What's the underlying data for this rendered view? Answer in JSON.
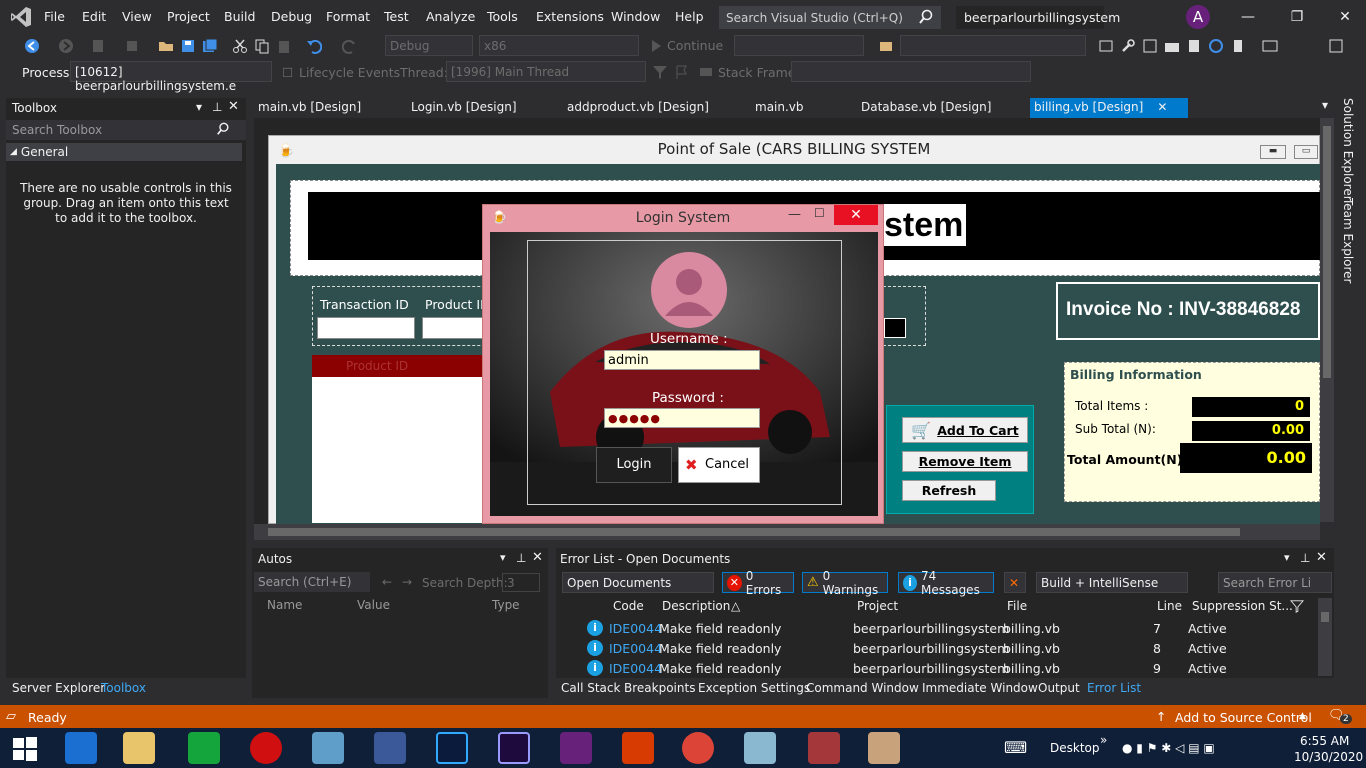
{
  "menu": [
    "File",
    "Edit",
    "View",
    "Project",
    "Build",
    "Debug",
    "Format",
    "Test",
    "Analyze",
    "Tools",
    "Extensions",
    "Window",
    "Help"
  ],
  "search_placeholder": "Search Visual Studio (Ctrl+Q)",
  "solution_name": "beerparlourbillingsystem",
  "avatar_letter": "A",
  "toolbar": {
    "config": "Debug",
    "platform": "x86",
    "continue_label": "Continue"
  },
  "debug_location": {
    "process_label": "Process:",
    "process_value": "[10612] beerparlourbillingsystem.e",
    "lifecycle_label": "Lifecycle Events",
    "thread_label": "Thread:",
    "thread_value": "[1996] Main Thread",
    "stackframe_label": "Stack Frame:"
  },
  "toolbox": {
    "title": "Toolbox",
    "search_placeholder": "Search Toolbox",
    "group": "General",
    "empty_text": "There are no usable controls in this group. Drag an item onto this text to add it to the toolbox.",
    "bottom_tabs": [
      "Server Explorer",
      "Toolbox"
    ]
  },
  "doc_tabs": [
    "main.vb [Design]",
    "Login.vb [Design]",
    "addproduct.vb [Design]",
    "main.vb",
    "Database.vb [Design]",
    "billing.vb [Design]"
  ],
  "side_tabs": [
    "Solution Explorer",
    "Team Explorer"
  ],
  "designer": {
    "form_title": "Point of Sale (CARS BILLING SYSTEM",
    "header_text": "stem",
    "transaction_id_label": "Transaction ID",
    "product_id_label": "Product ID",
    "grid_header": "Product ID",
    "add_to_cart": "Add To Cart",
    "remove_item": "Remove Item",
    "refresh": "Refresh",
    "invoice": "Invoice No : INV-38846828",
    "billing_info_title": "Billing Information",
    "total_items_label": "Total Items :",
    "total_items_value": "0",
    "subtotal_label": "Sub Total (N):",
    "subtotal_value": "0.00",
    "total_amount_label": "Total Amount(N) :",
    "total_amount_value": "0.00"
  },
  "login": {
    "title": "Login System",
    "username_label": "Username :",
    "username_value": "admin",
    "password_label": "Password :",
    "password_value": "●●●●●",
    "login_button": "Login",
    "cancel_button": "Cancel"
  },
  "autos": {
    "title": "Autos",
    "search_placeholder": "Search (Ctrl+E)",
    "search_depth_label": "Search Depth:",
    "search_depth_value": "3",
    "columns": [
      "Name",
      "Value",
      "Type"
    ]
  },
  "error_list": {
    "title": "Error List - Open Documents",
    "scope": "Open Documents",
    "errors": "0 Errors",
    "warnings": "0 Warnings",
    "messages": "74 Messages",
    "build_filter": "Build + IntelliSense",
    "search_placeholder": "Search Error Li",
    "columns": [
      "Code",
      "Description",
      "Project",
      "File",
      "Line",
      "Suppression St..."
    ],
    "rows": [
      {
        "code": "IDE0044",
        "description": "Make field readonly",
        "project": "beerparlourbillingsystem",
        "file": "billing.vb",
        "line": "7",
        "state": "Active"
      },
      {
        "code": "IDE0044",
        "description": "Make field readonly",
        "project": "beerparlourbillingsystem",
        "file": "billing.vb",
        "line": "8",
        "state": "Active"
      },
      {
        "code": "IDE0044",
        "description": "Make field readonly",
        "project": "beerparlourbillingsystem",
        "file": "billing.vb",
        "line": "9",
        "state": "Active"
      }
    ]
  },
  "bottom_tabs": [
    "Call Stack",
    "Breakpoints",
    "Exception Settings",
    "Command Window",
    "Immediate Window",
    "Output",
    "Error List"
  ],
  "status": {
    "ready": "Ready",
    "source_control": "Add to Source Control",
    "notifications": "2"
  },
  "taskbar": {
    "desktop_label": "Desktop",
    "time": "6:55 AM",
    "date": "10/30/2020"
  },
  "colors": {
    "accent": "#007acc",
    "status_bar": "#ca5100",
    "form_teal": "#2f4f4f",
    "cart_teal": "#008080",
    "login_pink": "#e79aa6"
  }
}
